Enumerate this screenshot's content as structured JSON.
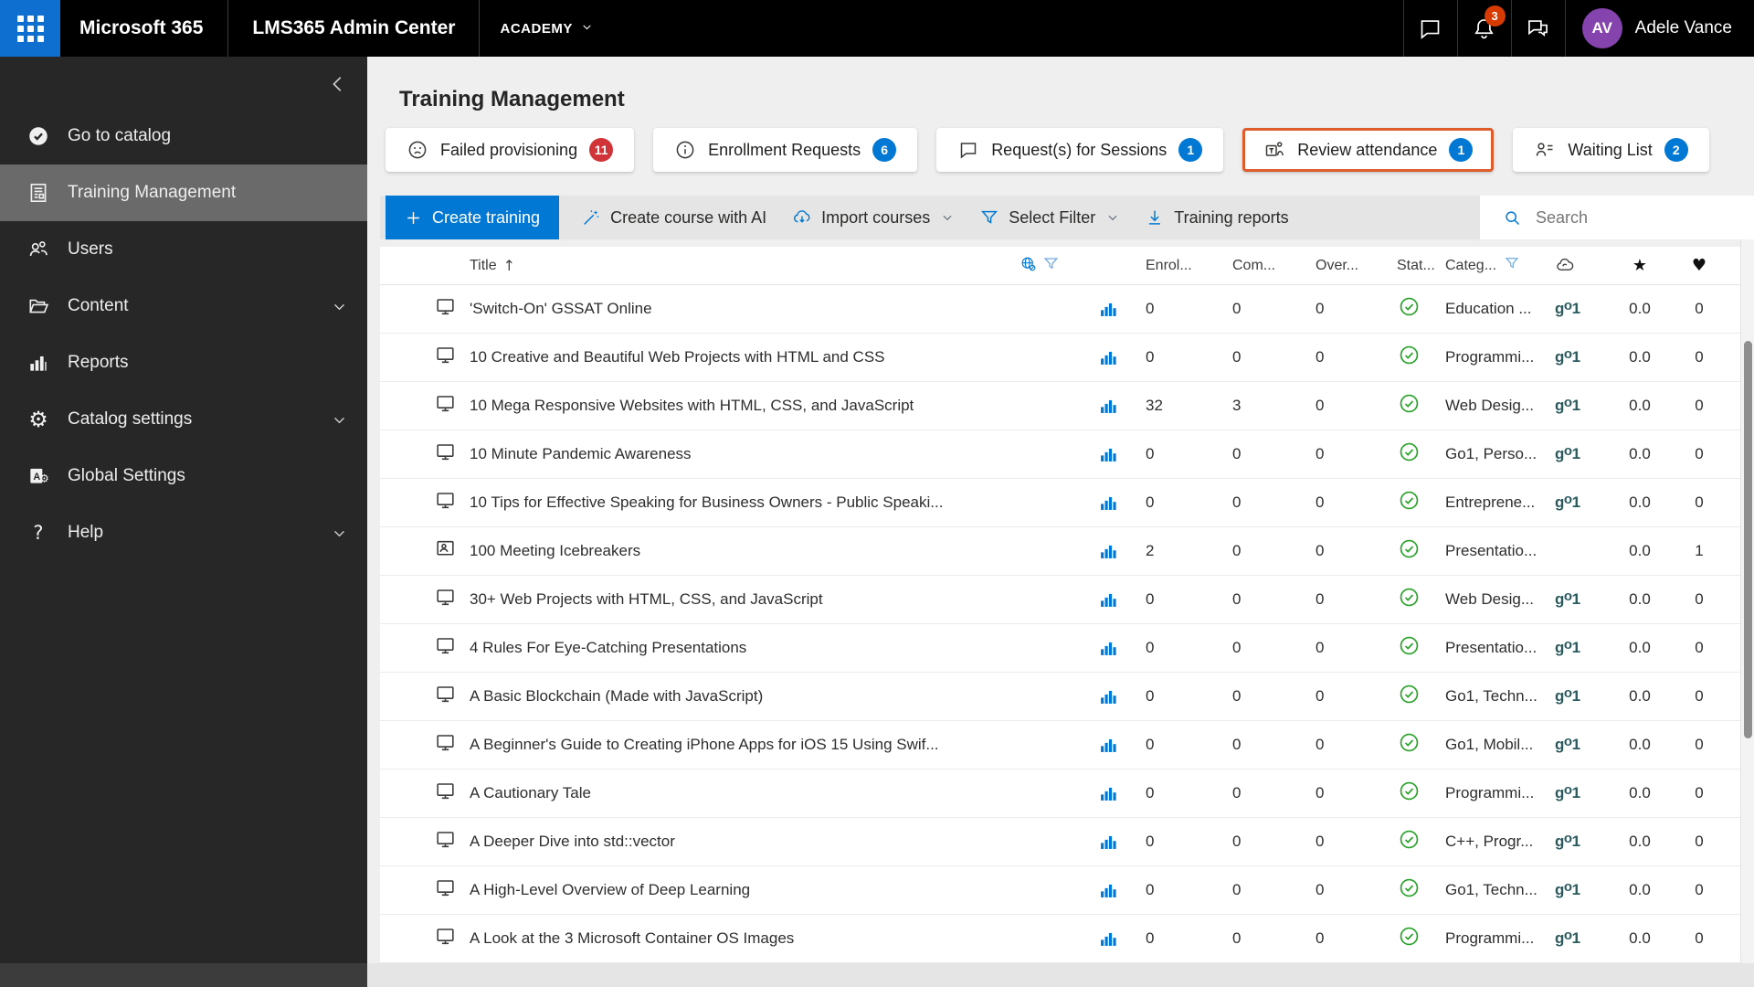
{
  "top_bar": {
    "brand": "Microsoft 365",
    "admin_center": "LMS365 Admin Center",
    "tenant": "ACADEMY",
    "notification_count": "3",
    "user": {
      "initials": "AV",
      "name": "Adele Vance"
    }
  },
  "sidebar": {
    "items": [
      {
        "label": "Go to catalog",
        "icon": "catalog-check",
        "selected": false,
        "expandable": false
      },
      {
        "label": "Training Management",
        "icon": "training-doc",
        "selected": true,
        "expandable": false
      },
      {
        "label": "Users",
        "icon": "users",
        "selected": false,
        "expandable": false
      },
      {
        "label": "Content",
        "icon": "folder",
        "selected": false,
        "expandable": true
      },
      {
        "label": "Reports",
        "icon": "reports",
        "selected": false,
        "expandable": false
      },
      {
        "label": "Catalog settings",
        "icon": "gear",
        "selected": false,
        "expandable": true
      },
      {
        "label": "Global Settings",
        "icon": "global-a",
        "selected": false,
        "expandable": false
      },
      {
        "label": "Help",
        "icon": "help",
        "selected": false,
        "expandable": true
      }
    ]
  },
  "page": {
    "title": "Training Management"
  },
  "tabs": [
    {
      "label": "Failed provisioning",
      "count": "11",
      "badge_color": "#d13438",
      "icon": "sad-face",
      "selected": false
    },
    {
      "label": "Enrollment Requests",
      "count": "6",
      "badge_color": "#0078d4",
      "icon": "info",
      "selected": false
    },
    {
      "label": "Request(s) for Sessions",
      "count": "1",
      "badge_color": "#0078d4",
      "icon": "chat-bubble",
      "selected": false
    },
    {
      "label": "Review attendance",
      "count": "1",
      "badge_color": "#0078d4",
      "icon": "teams",
      "selected": true
    },
    {
      "label": "Waiting List",
      "count": "2",
      "badge_color": "#0078d4",
      "icon": "person-list",
      "selected": false
    }
  ],
  "toolbar": {
    "create_training": "Create training",
    "create_course_ai": "Create course with AI",
    "import_courses": "Import courses",
    "select_filter": "Select Filter",
    "training_reports": "Training reports",
    "search_placeholder": "Search"
  },
  "table": {
    "columns": {
      "title": "Title",
      "enrolled": "Enrol...",
      "completed": "Com...",
      "overdue": "Over...",
      "status": "Stat...",
      "category": "Categ..."
    },
    "rows": [
      {
        "icon": "course",
        "title": "'Switch-On' GSSAT Online",
        "enrolled": "0",
        "completed": "0",
        "overdue": "0",
        "status": "published",
        "category": "Education ...",
        "go1": true,
        "rating": "0.0",
        "likes": "0"
      },
      {
        "icon": "course",
        "title": "10 Creative and Beautiful Web Projects with HTML and CSS",
        "enrolled": "0",
        "completed": "0",
        "overdue": "0",
        "status": "published",
        "category": "Programmi...",
        "go1": true,
        "rating": "0.0",
        "likes": "0"
      },
      {
        "icon": "course",
        "title": "10 Mega Responsive Websites with HTML, CSS, and JavaScript",
        "enrolled": "32",
        "completed": "3",
        "overdue": "0",
        "status": "published",
        "category": "Web Desig...",
        "go1": true,
        "rating": "0.0",
        "likes": "0"
      },
      {
        "icon": "course",
        "title": "10 Minute Pandemic Awareness",
        "enrolled": "0",
        "completed": "0",
        "overdue": "0",
        "status": "published",
        "category": "Go1, Perso...",
        "go1": true,
        "rating": "0.0",
        "likes": "0"
      },
      {
        "icon": "course",
        "title": "10 Tips for Effective Speaking for Business Owners - Public Speaki...",
        "enrolled": "0",
        "completed": "0",
        "overdue": "0",
        "status": "published",
        "category": "Entreprene...",
        "go1": true,
        "rating": "0.0",
        "likes": "0"
      },
      {
        "icon": "webinar",
        "title": "100 Meeting Icebreakers",
        "enrolled": "2",
        "completed": "0",
        "overdue": "0",
        "status": "published",
        "category": "Presentatio...",
        "go1": false,
        "rating": "0.0",
        "likes": "1"
      },
      {
        "icon": "course",
        "title": "30+ Web Projects with HTML, CSS, and JavaScript",
        "enrolled": "0",
        "completed": "0",
        "overdue": "0",
        "status": "published",
        "category": "Web Desig...",
        "go1": true,
        "rating": "0.0",
        "likes": "0"
      },
      {
        "icon": "course",
        "title": "4 Rules For Eye-Catching Presentations",
        "enrolled": "0",
        "completed": "0",
        "overdue": "0",
        "status": "published",
        "category": "Presentatio...",
        "go1": true,
        "rating": "0.0",
        "likes": "0"
      },
      {
        "icon": "course",
        "title": "A Basic Blockchain (Made with JavaScript)",
        "enrolled": "0",
        "completed": "0",
        "overdue": "0",
        "status": "published",
        "category": "Go1, Techn...",
        "go1": true,
        "rating": "0.0",
        "likes": "0"
      },
      {
        "icon": "course",
        "title": "A Beginner's Guide to Creating iPhone Apps for iOS 15 Using Swif...",
        "enrolled": "0",
        "completed": "0",
        "overdue": "0",
        "status": "published",
        "category": "Go1, Mobil...",
        "go1": true,
        "rating": "0.0",
        "likes": "0"
      },
      {
        "icon": "course",
        "title": "A Cautionary Tale",
        "enrolled": "0",
        "completed": "0",
        "overdue": "0",
        "status": "published",
        "category": "Programmi...",
        "go1": true,
        "rating": "0.0",
        "likes": "0"
      },
      {
        "icon": "course",
        "title": "A Deeper Dive into std::vector",
        "enrolled": "0",
        "completed": "0",
        "overdue": "0",
        "status": "published",
        "category": "C++, Progr...",
        "go1": true,
        "rating": "0.0",
        "likes": "0"
      },
      {
        "icon": "course",
        "title": "A High-Level Overview of Deep Learning",
        "enrolled": "0",
        "completed": "0",
        "overdue": "0",
        "status": "published",
        "category": "Go1, Techn...",
        "go1": true,
        "rating": "0.0",
        "likes": "0"
      },
      {
        "icon": "course",
        "title": "A Look at the 3 Microsoft Container OS Images",
        "enrolled": "0",
        "completed": "0",
        "overdue": "0",
        "status": "published",
        "category": "Programmi...",
        "go1": true,
        "rating": "0.0",
        "likes": "0"
      }
    ]
  },
  "colors": {
    "accent_blue": "#0078d4",
    "badge_red": "#d13438",
    "selected_tab_border": "#de5d2d",
    "status_green": "#28a228",
    "topbar_badge": "#d83b01",
    "go1_logo": "#2b5a5e",
    "avatar_purple": "#8443ad"
  }
}
